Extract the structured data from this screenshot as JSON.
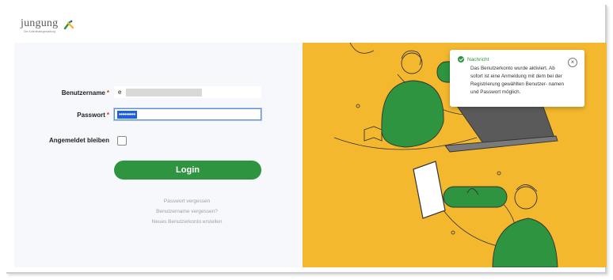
{
  "brand": {
    "logo_text": "jungung",
    "logo_tagline": "Der Aufenthaltsgestaltung"
  },
  "form": {
    "username_label": "Benutzername",
    "username_value": "e",
    "password_label": "Passwort",
    "password_value": "•••••••••",
    "required_mark": "*",
    "remember_label": "Angemeldet bleiben",
    "login_label": "Login"
  },
  "links": {
    "forgot_password": "Passwort vergessen",
    "forgot_username": "Benutzername vergessen?",
    "create_account": "Neues Benutzerkonto erstellen"
  },
  "toast": {
    "icon": "check-circle-icon",
    "title": "Nachricht",
    "body": "Das Benutzerkonto wurde aktiviert. Ab sofort ist eine Anmeldung mit dem bei der Registrierung gewählten Benutzer- namen und Passwort möglich.",
    "close_glyph": "×"
  },
  "colors": {
    "primary_green": "#2e9440",
    "illustration_bg": "#f3b82e",
    "required_red": "#e0302a",
    "focus_blue": "#5b8fd6"
  }
}
